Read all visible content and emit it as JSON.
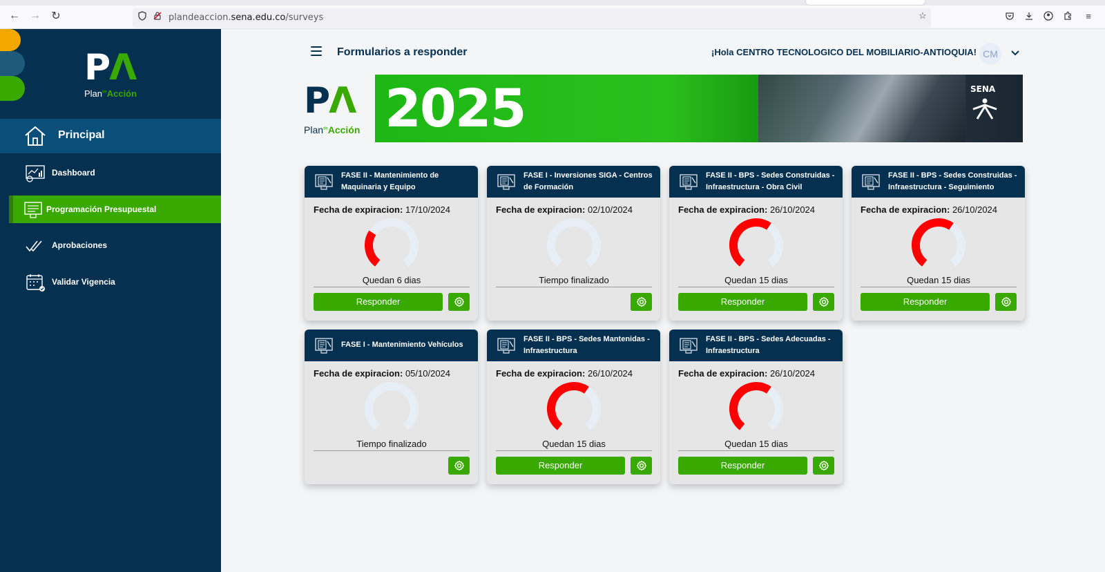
{
  "browser": {
    "url_prefix": "plandeaccion.",
    "url_domain": "sena.edu.co",
    "url_path": "/surveys"
  },
  "sidebar": {
    "logo_letters": "PA",
    "logo_plan": "Plan",
    "logo_de": "de",
    "logo_accion": "Acción",
    "principal": "Principal",
    "items": [
      {
        "label": "Dashboard",
        "icon": "dashboard-icon",
        "active": false
      },
      {
        "label": "Programación Presupuestal",
        "icon": "budget-icon",
        "active": true
      },
      {
        "label": "Aprobaciones",
        "icon": "double-check-icon",
        "active": false
      },
      {
        "label": "Validar Vigencia",
        "icon": "calendar-check-icon",
        "active": false
      }
    ]
  },
  "header": {
    "title": "Formularios a responder",
    "greeting": "¡Hola CENTRO TECNOLOGICO DEL MOBILIARIO-ANTIOQUIA!",
    "avatar": "CM"
  },
  "banner": {
    "logo_letters": "PA",
    "plan": "Plan",
    "de": "de",
    "accion": "Acción",
    "year": "2025",
    "sena": "SENA"
  },
  "cards": [
    {
      "title": "FASE II - Mantenimiento de Maquinaria y Equipo",
      "exp_label": "Fecha de expiracion:",
      "exp_date": "17/10/2024",
      "status": "Quedan 6 dias",
      "progress": 0.3,
      "respond": "Responder"
    },
    {
      "title": "FASE I - Inversiones SIGA - Centros de Formación",
      "exp_label": "Fecha de expiracion:",
      "exp_date": "02/10/2024",
      "status": "Tiempo finalizado",
      "progress": 0,
      "respond": ""
    },
    {
      "title": "FASE II - BPS - Sedes Construidas - Infraestructura - Obra Civil",
      "exp_label": "Fecha de expiracion:",
      "exp_date": "26/10/2024",
      "status": "Quedan 15 dias",
      "progress": 0.62,
      "respond": "Responder"
    },
    {
      "title": "FASE II - BPS - Sedes Construidas - Infraestructura - Seguimiento",
      "exp_label": "Fecha de expiracion:",
      "exp_date": "26/10/2024",
      "status": "Quedan 15 dias",
      "progress": 0.62,
      "respond": "Responder"
    },
    {
      "title": "FASE I - Mantenimiento Vehículos",
      "exp_label": "Fecha de expiracion:",
      "exp_date": "05/10/2024",
      "status": "Tiempo finalizado",
      "progress": 0,
      "respond": ""
    },
    {
      "title": "FASE II - BPS - Sedes Mantenidas - Infraestructura",
      "exp_label": "Fecha de expiracion:",
      "exp_date": "26/10/2024",
      "status": "Quedan 15 dias",
      "progress": 0.62,
      "respond": "Responder"
    },
    {
      "title": "FASE II - BPS - Sedes Adecuadas - Infraestructura",
      "exp_label": "Fecha de expiracion:",
      "exp_date": "26/10/2024",
      "status": "Quedan 15 dias",
      "progress": 0.62,
      "respond": "Responder"
    }
  ],
  "colors": {
    "navy": "#06304f",
    "green": "#39a900",
    "gauge_fill": "#ff0000",
    "gauge_track": "#e8eef5"
  }
}
